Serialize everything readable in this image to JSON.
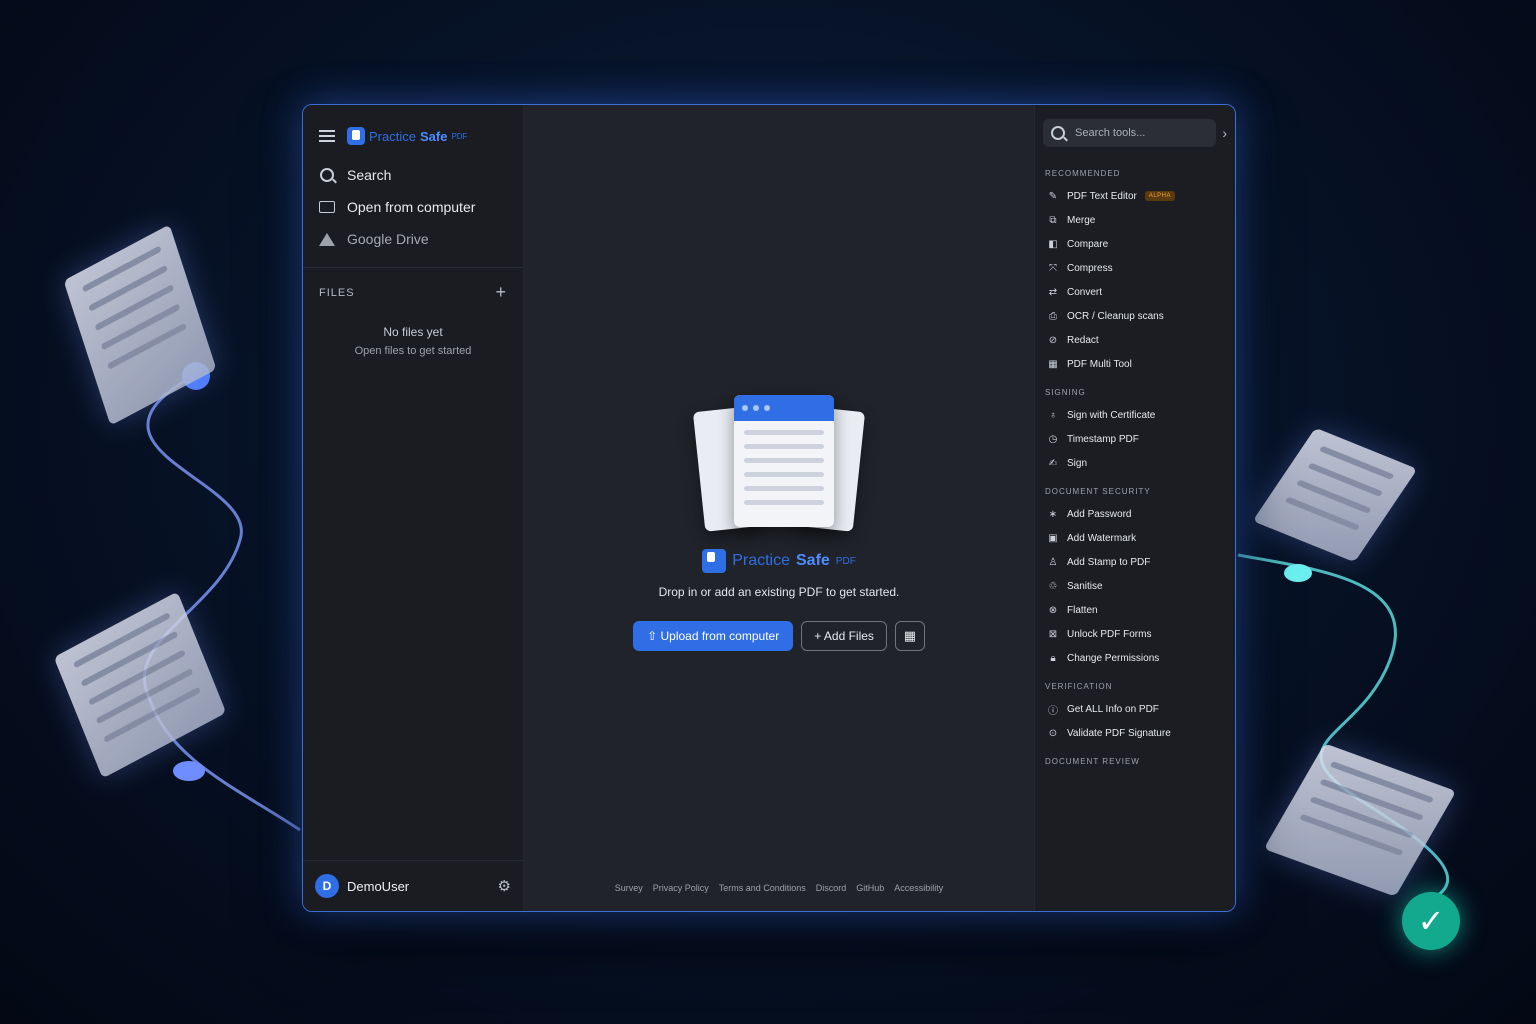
{
  "app": {
    "logo": {
      "part1": "Practice",
      "part2": "Safe",
      "part3": "PDF"
    }
  },
  "sidebar": {
    "nav": [
      {
        "label": "Search",
        "icon": "search-icon"
      },
      {
        "label": "Open from computer",
        "icon": "folder-icon"
      },
      {
        "label": "Google Drive",
        "icon": "google-drive-icon"
      }
    ],
    "files_title": "FILES",
    "empty_title": "No files yet",
    "empty_subtitle": "Open files to get started",
    "user": {
      "initial": "D",
      "name": "DemoUser"
    }
  },
  "main": {
    "tagline": "Drop in or add an existing PDF to get started.",
    "upload_label": "Upload from computer",
    "add_files_label": "Add Files",
    "footer_links": [
      "Survey",
      "Privacy Policy",
      "Terms and Conditions",
      "Discord",
      "GitHub",
      "Accessibility"
    ]
  },
  "tools": {
    "search_placeholder": "Search tools...",
    "sections": [
      {
        "title": "RECOMMENDED",
        "items": [
          {
            "label": "PDF Text Editor",
            "icon": "edit-icon",
            "badge": "ALPHA"
          },
          {
            "label": "Merge",
            "icon": "merge-icon"
          },
          {
            "label": "Compare",
            "icon": "compare-icon"
          },
          {
            "label": "Compress",
            "icon": "compress-icon"
          },
          {
            "label": "Convert",
            "icon": "convert-icon"
          },
          {
            "label": "OCR / Cleanup scans",
            "icon": "ocr-icon"
          },
          {
            "label": "Redact",
            "icon": "redact-icon"
          },
          {
            "label": "PDF Multi Tool",
            "icon": "multi-tool-icon"
          }
        ]
      },
      {
        "title": "SIGNING",
        "items": [
          {
            "label": "Sign with Certificate",
            "icon": "certificate-icon"
          },
          {
            "label": "Timestamp PDF",
            "icon": "clock-icon"
          },
          {
            "label": "Sign",
            "icon": "signature-icon"
          }
        ]
      },
      {
        "title": "DOCUMENT SECURITY",
        "items": [
          {
            "label": "Add Password",
            "icon": "password-icon"
          },
          {
            "label": "Add Watermark",
            "icon": "watermark-icon"
          },
          {
            "label": "Add Stamp to PDF",
            "icon": "stamp-icon"
          },
          {
            "label": "Sanitise",
            "icon": "sanitise-icon"
          },
          {
            "label": "Flatten",
            "icon": "flatten-icon"
          },
          {
            "label": "Unlock PDF Forms",
            "icon": "unlock-forms-icon"
          },
          {
            "label": "Change Permissions",
            "icon": "lock-icon"
          }
        ]
      },
      {
        "title": "VERIFICATION",
        "items": [
          {
            "label": "Get ALL Info on PDF",
            "icon": "info-icon"
          },
          {
            "label": "Validate PDF Signature",
            "icon": "validate-icon"
          }
        ]
      },
      {
        "title": "DOCUMENT REVIEW",
        "items": []
      }
    ]
  },
  "colors": {
    "accent": "#2f6ee5",
    "background": "#071328",
    "panel": "#1d2026"
  }
}
